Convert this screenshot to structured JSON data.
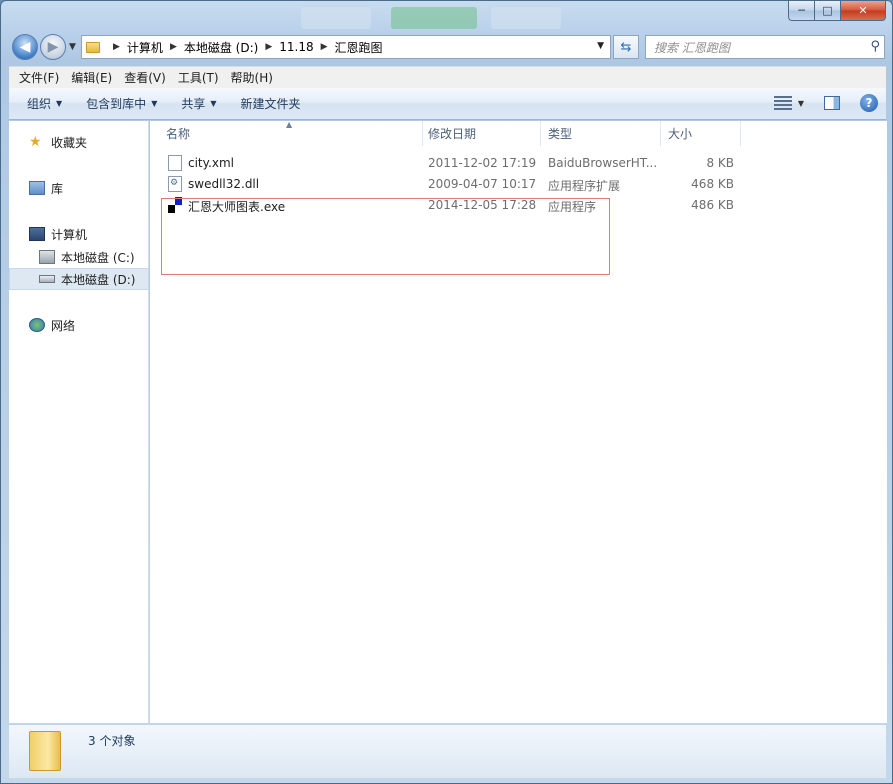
{
  "window": {
    "caption_buttons": {
      "minimize": "─",
      "maximize": "□",
      "close": "✕"
    }
  },
  "address": {
    "crumbs": [
      "计算机",
      "本地磁盘 (D:)",
      "11.18",
      "汇恩跑图"
    ],
    "search_placeholder": "搜索 汇恩跑图"
  },
  "menu": [
    "文件(F)",
    "编辑(E)",
    "查看(V)",
    "工具(T)",
    "帮助(H)"
  ],
  "toolbar": {
    "organize": "组织",
    "include_library": "包含到库中",
    "share": "共享",
    "new_folder": "新建文件夹"
  },
  "nav": {
    "favorites": "收藏夹",
    "libraries": "库",
    "computer": "计算机",
    "drive_c": "本地磁盘 (C:)",
    "drive_d": "本地磁盘 (D:)",
    "network": "网络"
  },
  "columns": {
    "name": "名称",
    "modified": "修改日期",
    "type": "类型",
    "size": "大小"
  },
  "files": [
    {
      "name": "city.xml",
      "modified": "2011-12-02 17:19",
      "type": "BaiduBrowserHT...",
      "size": "8 KB",
      "icon": "xml-file-icon"
    },
    {
      "name": "swedll32.dll",
      "modified": "2009-04-07 10:17",
      "type": "应用程序扩展",
      "size": "468 KB",
      "icon": "dll-file-icon"
    },
    {
      "name": "汇恩大师图表.exe",
      "modified": "2014-12-05 17:28",
      "type": "应用程序",
      "size": "486 KB",
      "icon": "exe-app-icon"
    }
  ],
  "status": {
    "count": "3 个对象"
  },
  "colors": {
    "accent": "#1e395b",
    "highlight_border": "#e07a7a"
  }
}
